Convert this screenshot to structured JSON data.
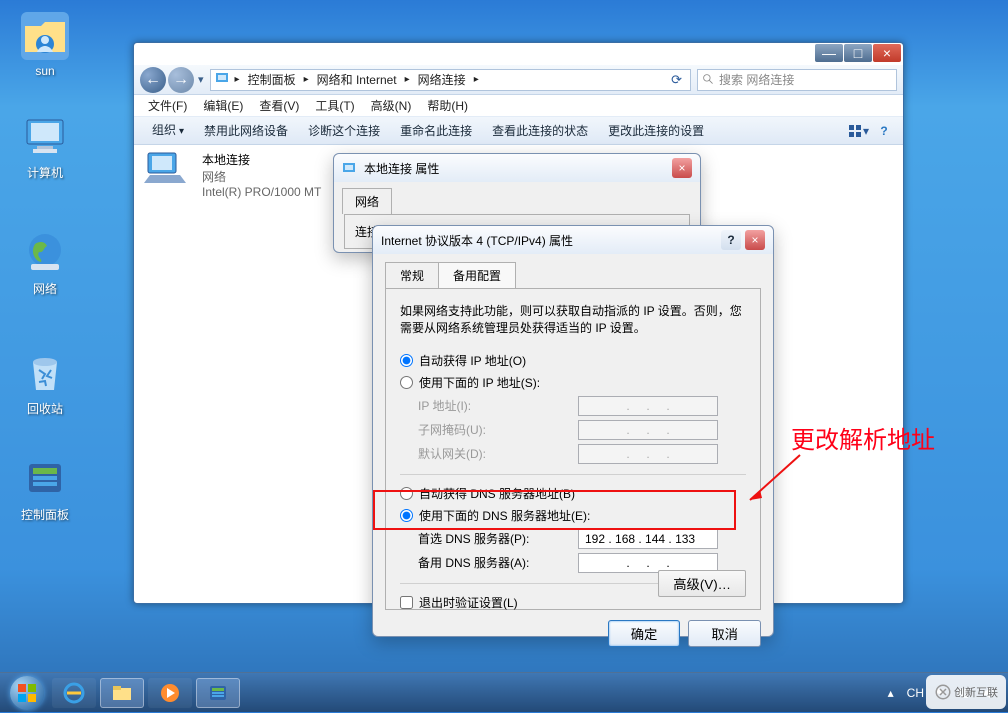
{
  "desktop": {
    "icons": [
      {
        "label": "sun"
      },
      {
        "label": "计算机"
      },
      {
        "label": "网络"
      },
      {
        "label": "回收站"
      },
      {
        "label": "控制面板"
      }
    ]
  },
  "explorer": {
    "crumbs": [
      "控制面板",
      "网络和 Internet",
      "网络连接"
    ],
    "search_placeholder": "搜索 网络连接",
    "menus": [
      "文件(F)",
      "编辑(E)",
      "查看(V)",
      "工具(T)",
      "高级(N)",
      "帮助(H)"
    ],
    "toolbar": {
      "org": "组织",
      "disable": "禁用此网络设备",
      "diag": "诊断这个连接",
      "rename": "重命名此连接",
      "status": "查看此连接的状态",
      "settings": "更改此连接的设置"
    },
    "item": {
      "name": "本地连接",
      "line2": "网络",
      "line3": "Intel(R) PRO/1000 MT"
    }
  },
  "dlg1": {
    "title": "本地连接 属性",
    "tab": "网络",
    "line": "连接时使用:"
  },
  "dlg2": {
    "title": "Internet 协议版本 4 (TCP/IPv4) 属性",
    "tabs": {
      "general": "常规",
      "alt": "备用配置"
    },
    "desc": "如果网络支持此功能，则可以获取自动指派的 IP 设置。否则，您需要从网络系统管理员处获得适当的 IP 设置。",
    "ip_auto": "自动获得 IP 地址(O)",
    "ip_manual": "使用下面的 IP 地址(S):",
    "ip_addr_lbl": "IP 地址(I):",
    "subnet_lbl": "子网掩码(U):",
    "gateway_lbl": "默认网关(D):",
    "dns_auto": "自动获得 DNS 服务器地址(B)",
    "dns_manual": "使用下面的 DNS 服务器地址(E):",
    "dns_pref_lbl": "首选 DNS 服务器(P):",
    "dns_pref_val": "192 . 168 . 144 . 133",
    "dns_alt_lbl": "备用 DNS 服务器(A):",
    "validate": "退出时验证设置(L)",
    "advanced": "高级(V)…",
    "ok": "确定",
    "cancel": "取消"
  },
  "annotation": {
    "text": "更改解析地址"
  },
  "tray": {
    "lang": "CH"
  },
  "watermark": "创新互联"
}
